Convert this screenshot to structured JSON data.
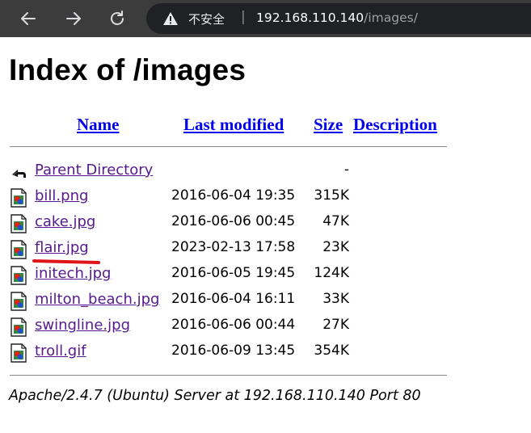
{
  "browser": {
    "security_label": "不安全",
    "url_host": "192.168.110.140",
    "url_path": "/images/",
    "icons": [
      "back-arrow-icon",
      "forward-arrow-icon",
      "reload-icon",
      "warning-icon"
    ]
  },
  "page": {
    "title": "Index of /images",
    "columns": {
      "name": "Name",
      "last_modified": "Last modified",
      "size": "Size",
      "description": "Description"
    },
    "parent": {
      "name": "Parent Directory",
      "size": "-",
      "icon": "back-folder-icon"
    },
    "files": [
      {
        "name": "bill.png",
        "modified": "2016-06-04 19:35",
        "size": "315K",
        "icon": "image-file-icon"
      },
      {
        "name": "cake.jpg",
        "modified": "2016-06-06 00:45",
        "size": "47K",
        "icon": "image-file-icon"
      },
      {
        "name": "flair.jpg",
        "modified": "2023-02-13 17:58",
        "size": "23K",
        "icon": "image-file-icon"
      },
      {
        "name": "initech.jpg",
        "modified": "2016-06-05 19:45",
        "size": "124K",
        "icon": "image-file-icon"
      },
      {
        "name": "milton_beach.jpg",
        "modified": "2016-06-04 16:11",
        "size": "33K",
        "icon": "image-file-icon"
      },
      {
        "name": "swingline.jpg",
        "modified": "2016-06-06 00:44",
        "size": "27K",
        "icon": "image-file-icon"
      },
      {
        "name": "troll.gif",
        "modified": "2016-06-09 13:45",
        "size": "354K",
        "icon": "image-file-icon"
      }
    ],
    "footer": "Apache/2.4.7 (Ubuntu) Server at 192.168.110.140 Port 80"
  },
  "colors": {
    "toolbar": "#3c3c3c",
    "omnibox": "#202124",
    "link": "#0000ee",
    "visited_link": "#551a8b",
    "annotation": "#e0141b"
  }
}
